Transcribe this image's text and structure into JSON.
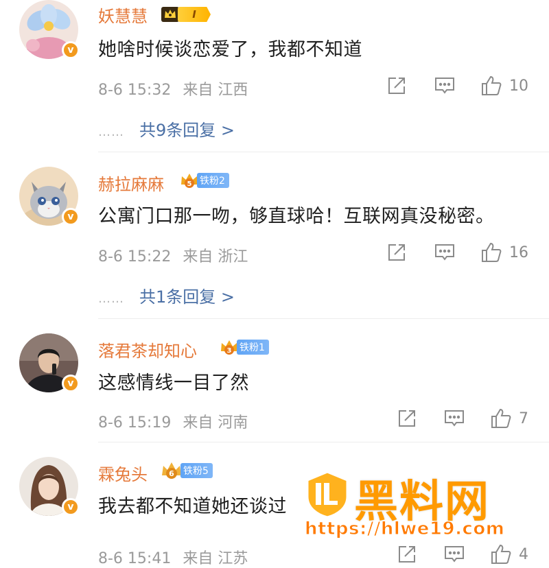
{
  "comments": [
    {
      "username": "妖慧慧",
      "badge": {
        "type": "vip",
        "level": "I"
      },
      "text": "她啥时候谈恋爱了，我都不知道",
      "date": "8-6 15:32",
      "source": "来自 江西",
      "likes": "10",
      "replies": "共9条回复 >"
    },
    {
      "username": "赫拉麻麻",
      "badge": {
        "type": "fan",
        "crown_level": "5",
        "label": "铁粉2"
      },
      "text": "公寓门口那一吻，够直球哈！互联网真没秘密。",
      "date": "8-6 15:22",
      "source": "来自 浙江",
      "likes": "16",
      "replies": "共1条回复 >"
    },
    {
      "username": "落君茶却知心",
      "badge": {
        "type": "fan",
        "crown_level": "3",
        "label": "铁粉1"
      },
      "text": "这感情线一目了然",
      "date": "8-6 15:19",
      "source": "来自 河南",
      "likes": "7",
      "replies": ""
    },
    {
      "username": "霖兔头",
      "badge": {
        "type": "fan",
        "crown_level": "6",
        "label": "铁粉5"
      },
      "text": "我去都不知道她还谈过",
      "date": "8-6 15:41",
      "source": "来自 江苏",
      "likes": "4",
      "replies": ""
    }
  ],
  "ellipsis": "……",
  "verified_mark": "v",
  "icons": {
    "share": "share-icon",
    "comment": "comment-icon",
    "like": "thumbs-up-icon"
  },
  "watermark": {
    "title": "黑料网",
    "url": "https://hlwe19.com"
  },
  "colors": {
    "username": "#e5793a",
    "reply_link": "#4a6fa5",
    "meta": "#9a9a9a",
    "verified": "#f29a1e",
    "fan_pill": "#5fa4f5",
    "watermark": "#ff9a00"
  }
}
